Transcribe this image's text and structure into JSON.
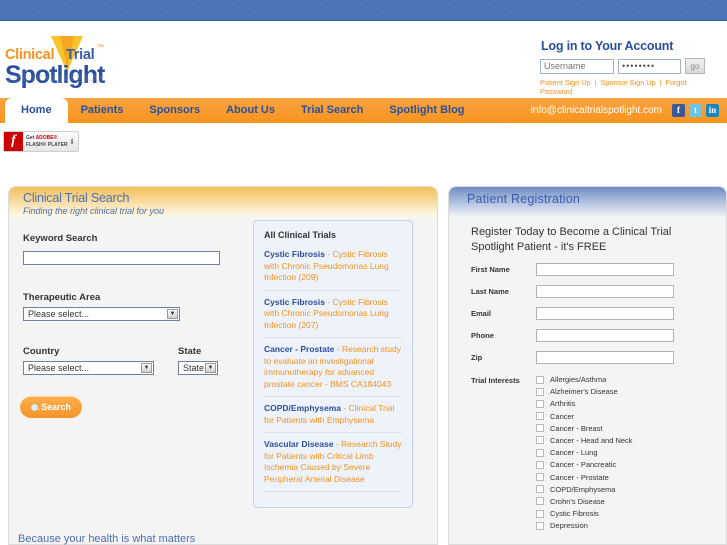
{
  "header": {
    "logo": {
      "line1_a": "Clinical",
      "line1_b": "Trial",
      "trademark": "™",
      "line2": "Spotlight"
    },
    "login": {
      "title": "Log in to Your Account",
      "username_placeholder": "Username",
      "password_value": "••••••••",
      "go_label": "go",
      "links": [
        "Patient Sign Up",
        "Sponsor Sign Up",
        "Forgot Password"
      ],
      "separator": "|"
    }
  },
  "nav": {
    "items": [
      {
        "label": "Home",
        "active": true
      },
      {
        "label": "Patients",
        "active": false
      },
      {
        "label": "Sponsors",
        "active": false
      },
      {
        "label": "About Us",
        "active": false
      },
      {
        "label": "Trial Search",
        "active": false
      },
      {
        "label": "Spotlight Blog",
        "active": false
      }
    ],
    "email": "info@clinicaltrialspotlight.com",
    "social": [
      {
        "name": "facebook-icon",
        "glyph": "f"
      },
      {
        "name": "twitter-icon",
        "glyph": "t"
      },
      {
        "name": "linkedin-icon",
        "glyph": "in"
      }
    ]
  },
  "flash_badge": {
    "get": "Get",
    "adobe": "ADOBE®",
    "player": "FLASH® PLAYER",
    "arrow": "⬇"
  },
  "search_panel": {
    "title": "Clinical Trial Search",
    "subtitle": "Finding the right clinical trial for you",
    "keyword_label": "Keyword Search",
    "keyword_value": "",
    "therapeutic_label": "Therapeutic Area",
    "therapeutic_value": "Please select...",
    "country_label": "Country",
    "country_value": "Please select...",
    "state_label": "State",
    "state_value": "State",
    "search_button": "Search",
    "tagline": "Because your health is what matters"
  },
  "trials": {
    "title": "All Clinical Trials",
    "items": [
      {
        "condition": "Cystic Fibrosis",
        "description": " - Cystic Fibrosis with Chronic Pseudomonas Lung Infection (209)"
      },
      {
        "condition": "Cystic Fibrosis",
        "description": " - Cystic Fibrosis with Chronic Pseudomonas Lung Infection (207)"
      },
      {
        "condition": "Cancer - Prostate",
        "description": " - Research study to evaluate an investigational immunotherapy for advanced prostate cancer - BMS CA184043"
      },
      {
        "condition": "COPD/Emphysema",
        "description": " - Clinical Trial for Patients with Emphysema"
      },
      {
        "condition": "Vascular Disease",
        "description": " - Research Study for Patients with Critical Limb Ischemia Caused by Severe Peripheral Arterial Disease"
      }
    ]
  },
  "registration": {
    "title": "Patient Registration",
    "intro": "Register Today to Become a Clinical Trial Spotlight Patient - it's FREE",
    "fields": [
      {
        "label": "First Name",
        "value": ""
      },
      {
        "label": "Last Name",
        "value": ""
      },
      {
        "label": "Email",
        "value": ""
      },
      {
        "label": "Phone",
        "value": ""
      },
      {
        "label": "Zip",
        "value": ""
      }
    ],
    "interests_label": "Trial Interests",
    "interests": [
      "Allergies/Asthma",
      "Alzheimer's Disease",
      "Arthritis",
      "Cancer",
      "Cancer - Breast",
      "Cancer - Head and Neck",
      "Cancer - Lung",
      "Cancer - Pancreatic",
      "Cancer - Prostate",
      "COPD/Emphysema",
      "Crohn's Disease",
      "Cystic Fibrosis",
      "Depression"
    ]
  },
  "colors": {
    "top_bar_blue": "#4a72b8",
    "nav_orange": "#f7941e",
    "link_blue": "#2a4f9e",
    "link_orange": "#f6921e"
  }
}
